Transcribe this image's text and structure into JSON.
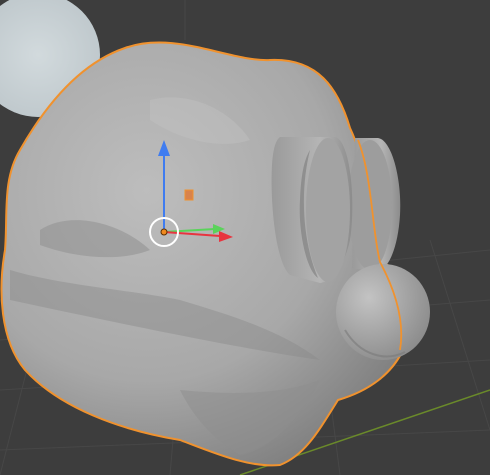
{
  "app": {
    "name": "3D viewport",
    "background_color": "#3d3d3d",
    "grid_color": "#474747",
    "x_axis_color": "#6a8a2a"
  },
  "scene": {
    "selected_object": {
      "outline_color": "#f0922e",
      "surface_color": "#a9a9a9"
    },
    "lamp_disc_color": "#c9d2d6",
    "gizmo": {
      "z_axis_color": "#3f7cf0",
      "y_axis_color": "#5ad35a",
      "x_axis_color": "#e8343f",
      "origin_color": "#f08a1e",
      "pivot_ring_color": "#ffffff",
      "handle_plane_color": "#e08a3a"
    }
  },
  "icons": {
    "pivot": "pivot-circle-icon",
    "origin": "origin-dot-icon",
    "plane_handle": "plane-handle-icon"
  }
}
